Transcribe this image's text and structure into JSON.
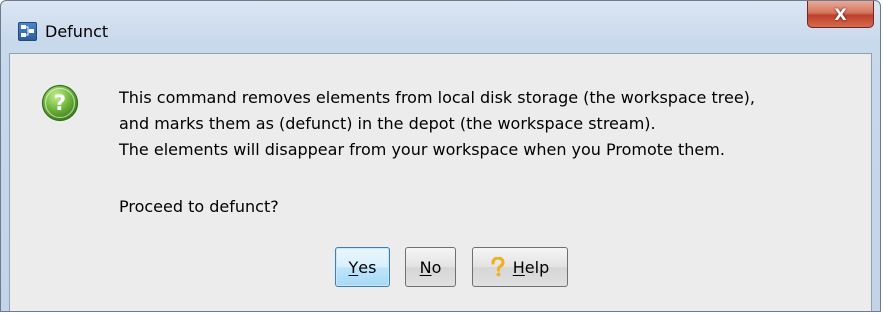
{
  "window": {
    "title": "Defunct",
    "close_glyph": "X"
  },
  "message": {
    "lines": [
      "This command removes elements from local disk storage (the workspace tree),",
      "and marks them as (defunct) in the depot (the workspace stream).",
      "The elements will disappear from your workspace when you Promote them."
    ],
    "prompt": "Proceed to defunct?"
  },
  "buttons": {
    "yes": {
      "mnemonic": "Y",
      "rest": "es"
    },
    "no": {
      "mnemonic": "N",
      "rest": "o"
    },
    "help": {
      "mnemonic": "H",
      "rest": "elp"
    }
  },
  "icons": {
    "app": "app-icon",
    "dialog": "question-icon",
    "help": "help-question-icon"
  },
  "colors": {
    "dialog_bg": "#ececec",
    "frame": "#c9d9ec",
    "close_red": "#c0402a",
    "default_button": "#bee6fd",
    "question_green": "#5aa02c",
    "help_yellow": "#f2b01e"
  }
}
